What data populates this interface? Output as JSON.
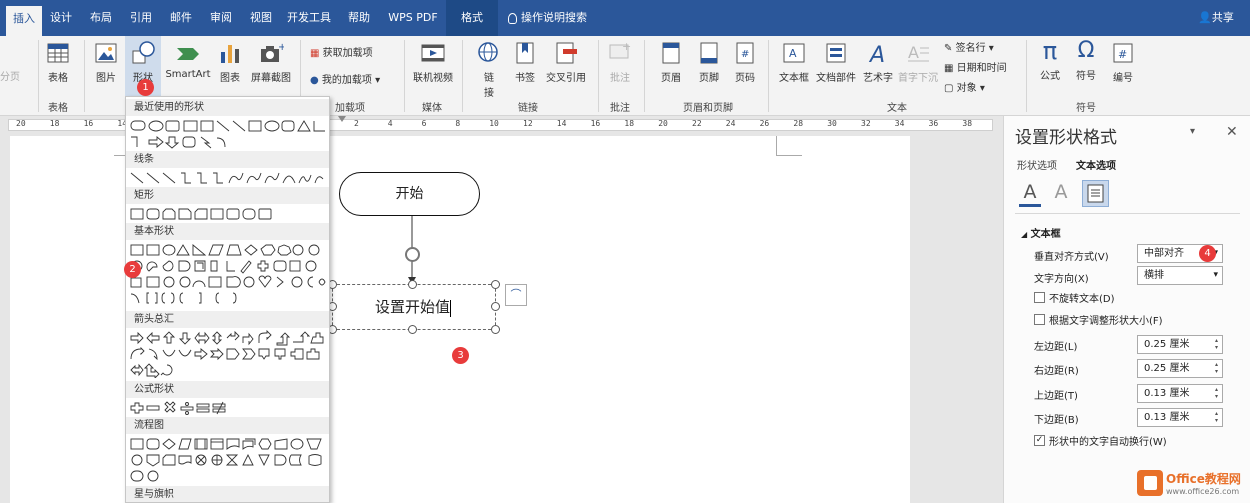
{
  "tabs": [
    "插入",
    "设计",
    "布局",
    "引用",
    "邮件",
    "审阅",
    "视图",
    "开发工具",
    "帮助",
    "WPS PDF",
    "格式"
  ],
  "tell_me": "操作说明搜索",
  "share": "共享",
  "ribbon": {
    "page_frag": "分页",
    "table": "表格",
    "picture": "图片",
    "shapes": "形状",
    "smartart": "SmartArt",
    "chart": "图表",
    "screenshot": "屏幕截图",
    "get_addins": "获取加载项",
    "my_addins": "我的加载项",
    "online_video": "联机视频",
    "link_a": "链",
    "link_b": "接",
    "bookmark": "书签",
    "crossref": "交叉引用",
    "comment": "批注",
    "header": "页眉",
    "footer": "页脚",
    "pagenum": "页码",
    "textbox": "文本框",
    "quickparts": "文档部件",
    "wordart": "艺术字",
    "dropcap": "首字下沉",
    "signature": "签名行",
    "datetime": "日期和时间",
    "object": "对象",
    "equation": "公式",
    "symbol": "符号",
    "number": "编号"
  },
  "groups": {
    "table": "表格",
    "addins": "加载项",
    "media": "媒体",
    "links": "链接",
    "comments": "批注",
    "hf": "页眉和页脚",
    "text": "文本",
    "symbols": "符号"
  },
  "ruler": [
    "20",
    "18",
    "16",
    "14",
    "12",
    "10",
    "8",
    "6",
    "4",
    "2",
    "2",
    "4",
    "6",
    "8",
    "10",
    "12",
    "14",
    "16",
    "18",
    "20",
    "22",
    "24",
    "26",
    "28",
    "30",
    "32",
    "34",
    "36",
    "38"
  ],
  "gallery": {
    "sections": [
      "最近使用的形状",
      "线条",
      "矩形",
      "基本形状",
      "箭头总汇",
      "公式形状",
      "流程图",
      "星与旗帜"
    ]
  },
  "doc": {
    "start": "开始",
    "box": "设置开始值"
  },
  "pane": {
    "title": "设置形状格式",
    "tab_shape": "形状选项",
    "tab_text": "文本选项",
    "section": "文本框",
    "valign_label": "垂直对齐方式(V)",
    "valign": "中部对齐",
    "dir_label": "文字方向(X)",
    "dir": "横排",
    "no_rotate": "不旋转文本(D)",
    "autofit": "根据文字调整形状大小(F)",
    "left_label": "左边距(L)",
    "left": "0.25 厘米",
    "right_label": "右边距(R)",
    "right": "0.25 厘米",
    "top_label": "上边距(T)",
    "top": "0.13 厘米",
    "bottom_label": "下边距(B)",
    "bottom": "0.13 厘米",
    "wrap": "形状中的文字自动换行(W)"
  },
  "badges": [
    "1",
    "2",
    "3",
    "4"
  ],
  "watermark": {
    "brand": "Office教程网",
    "url": "www.office26.com"
  },
  "colors": {
    "accent": "#2b579a",
    "badge": "#e83b3b",
    "icon_blue": "#2b579a"
  }
}
